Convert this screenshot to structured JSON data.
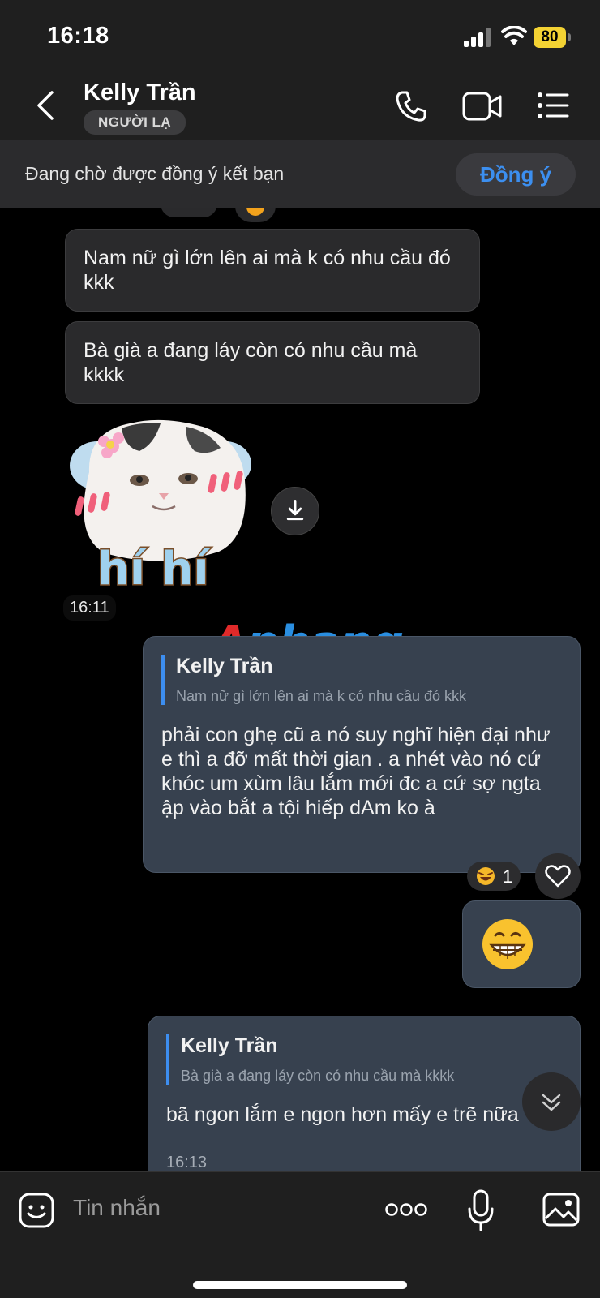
{
  "status_bar": {
    "time": "16:18",
    "battery": "80"
  },
  "header": {
    "name": "Kelly Trần",
    "badge": "NGƯỜI LẠ"
  },
  "friend_request": {
    "text": "Đang chờ được đồng ý kết bạn",
    "accept_label": "Đồng ý"
  },
  "messages": {
    "in1": {
      "text": "Nam nữ gì lớn lên ai mà k có nhu cầu đó kkk"
    },
    "in2": {
      "text": "Bà già a đang láy còn có nhu cầu mà kkkk"
    },
    "sticker": {
      "caption": "hí hí",
      "time": "16:11"
    },
    "out1": {
      "quote_name": "Kelly Trần",
      "quote_text": "Nam nữ gì lớn lên ai mà k có nhu cầu đó kkk",
      "text": "phải con ghẹ cũ a nó suy nghĩ hiện đại như e thì a đỡ mất thời gian . a nhét vào nó cứ khóc um xùm lâu lắm mới đc a cứ sợ ngta ập vào bắt a tội hiếp dAm ko à",
      "reaction_count": "1"
    },
    "out2": {
      "emoji": "😁"
    },
    "out3": {
      "quote_name": "Kelly Trần",
      "quote_text": "Bà già a đang láy còn có nhu cầu mà kkkk",
      "text": "bã ngon lắm e ngon hơn mấy e trẽ nữa",
      "time": "16:13"
    }
  },
  "watermark": {
    "first": "A",
    "rest": "phang"
  },
  "input": {
    "placeholder": "Tin nhắn"
  },
  "colors": {
    "accent": "#3c8ff0",
    "outgoing_bubble": "#37414f",
    "incoming_bubble": "#2a2a2c"
  }
}
